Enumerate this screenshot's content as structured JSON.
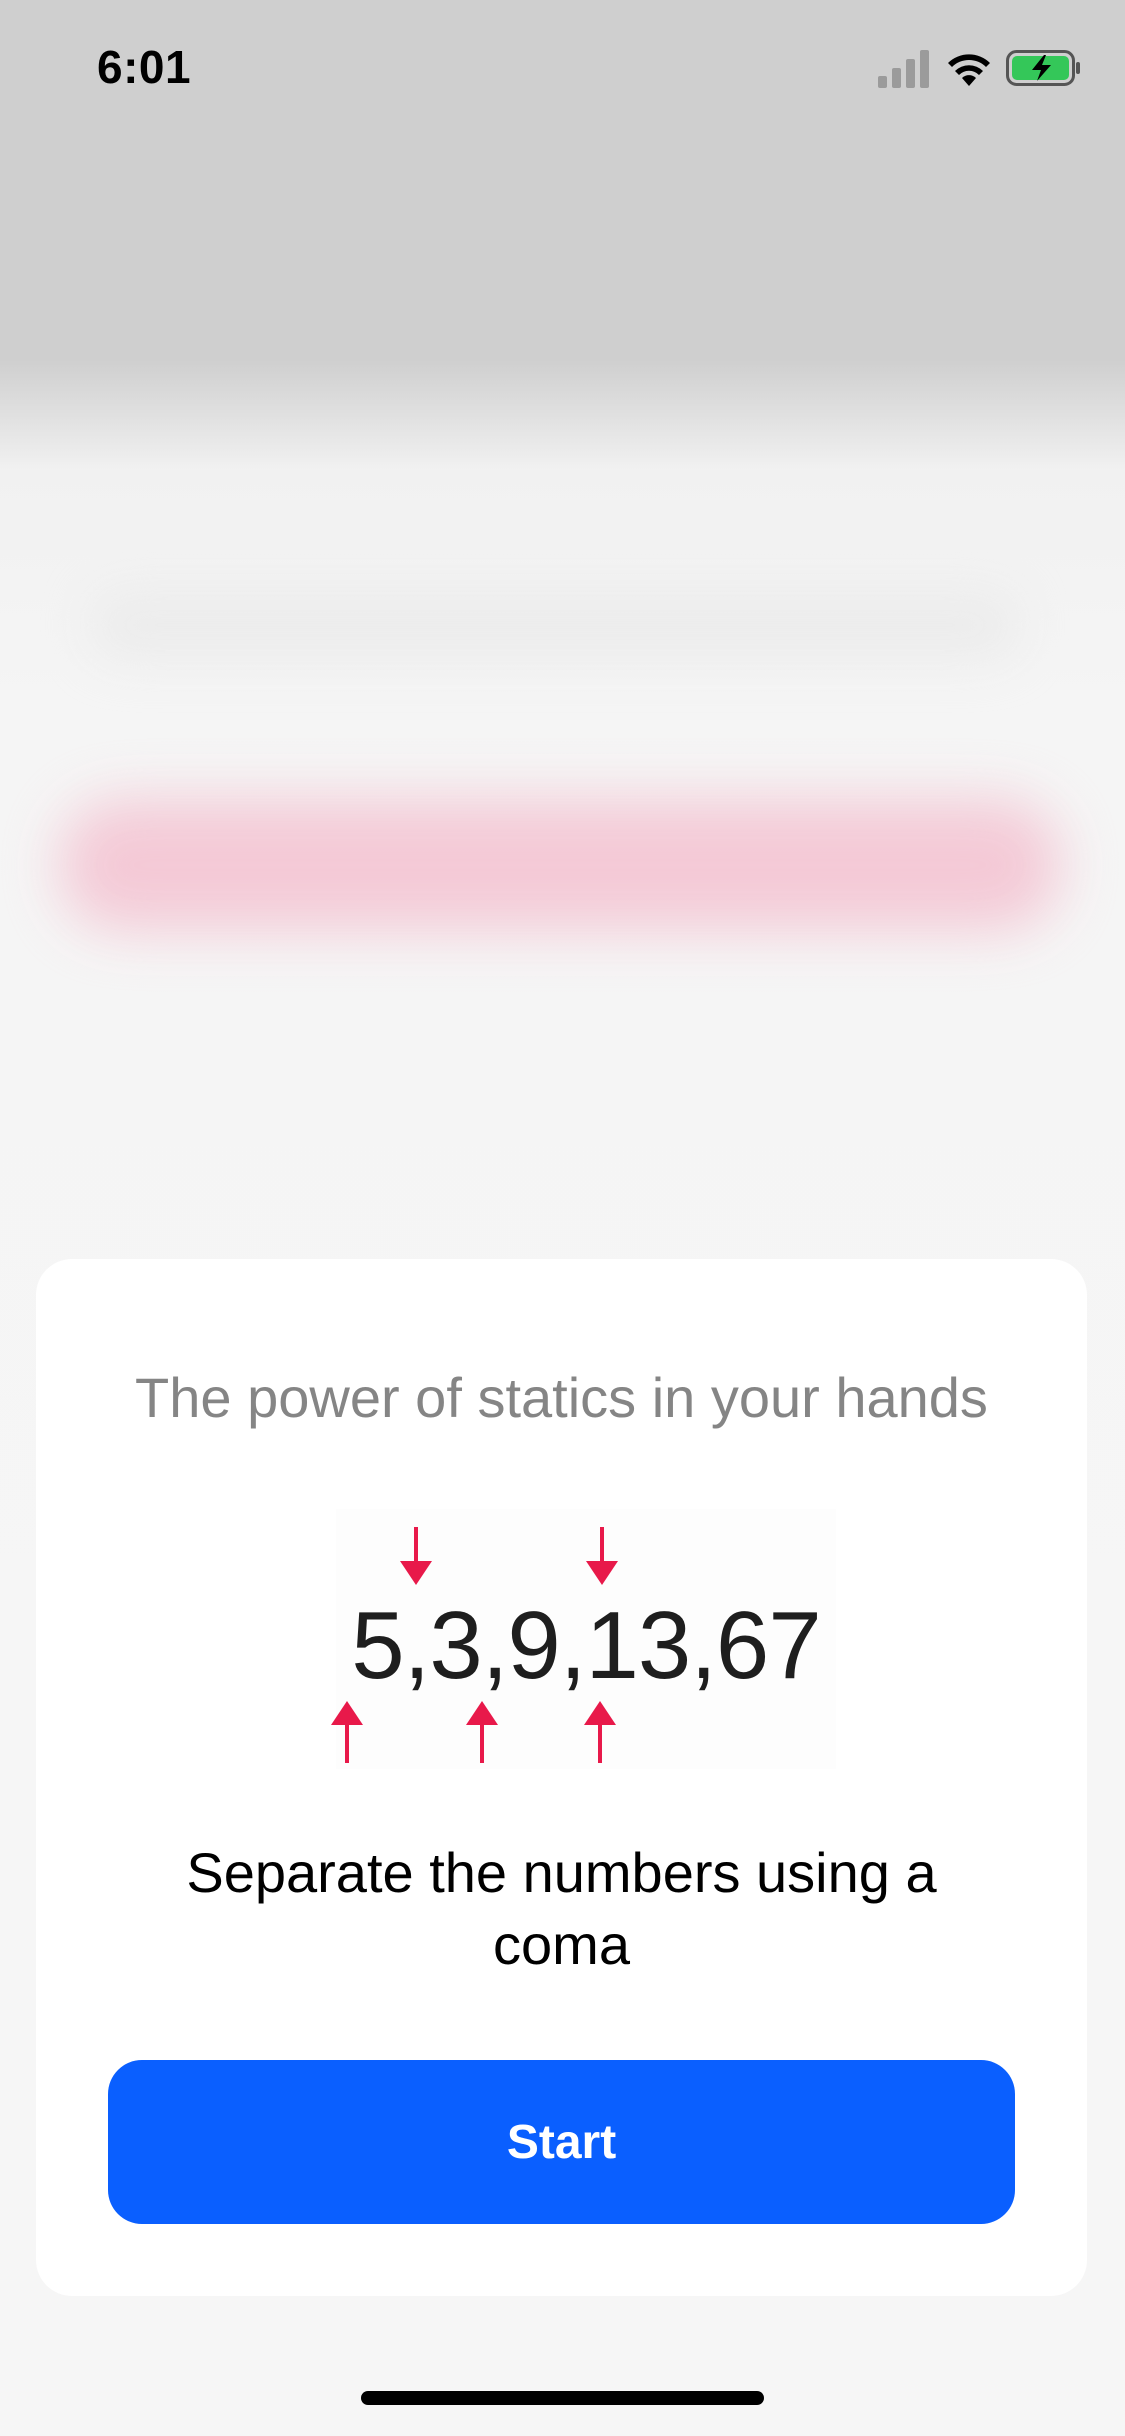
{
  "status_bar": {
    "time": "6:01",
    "icons": [
      "signal-icon",
      "wifi-icon",
      "battery-charging-icon"
    ],
    "battery_color": "#34c759"
  },
  "card": {
    "title": "The power of statics in your hands",
    "example_number": "5,3,9,13,67",
    "description": "Separate the numbers using a coma",
    "start_label": "Start",
    "arrow_color": "#e8194a",
    "accent_color": "#0a5fff"
  }
}
